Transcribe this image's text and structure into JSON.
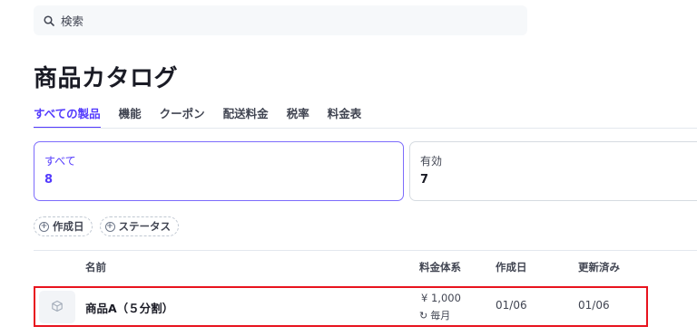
{
  "search": {
    "placeholder": "検索",
    "icon": "search-icon"
  },
  "page": {
    "title": "商品カタログ"
  },
  "tabs": [
    {
      "label": "すべての製品",
      "active": true
    },
    {
      "label": "機能"
    },
    {
      "label": "クーポン"
    },
    {
      "label": "配送料金"
    },
    {
      "label": "税率"
    },
    {
      "label": "料金表"
    }
  ],
  "summary_cards": [
    {
      "label": "すべて",
      "count": "8",
      "active": true
    },
    {
      "label": "有効",
      "count": "7"
    }
  ],
  "filters": [
    {
      "label": "作成日",
      "icon": "plus-circle-icon"
    },
    {
      "label": "ステータス",
      "icon": "plus-circle-icon"
    }
  ],
  "table": {
    "columns": [
      "名前",
      "料金体系",
      "作成日",
      "更新済み"
    ],
    "rows": [
      {
        "name": "商品A（５分割）",
        "price": "¥ 1,000",
        "interval": "毎月",
        "created": "01/06",
        "updated": "01/06",
        "icon": "cube-icon",
        "highlighted": true
      }
    ]
  },
  "colors": {
    "accent": "#533afd",
    "highlight": "#e8131e",
    "text": "#1a1b25",
    "muted": "#414552"
  }
}
